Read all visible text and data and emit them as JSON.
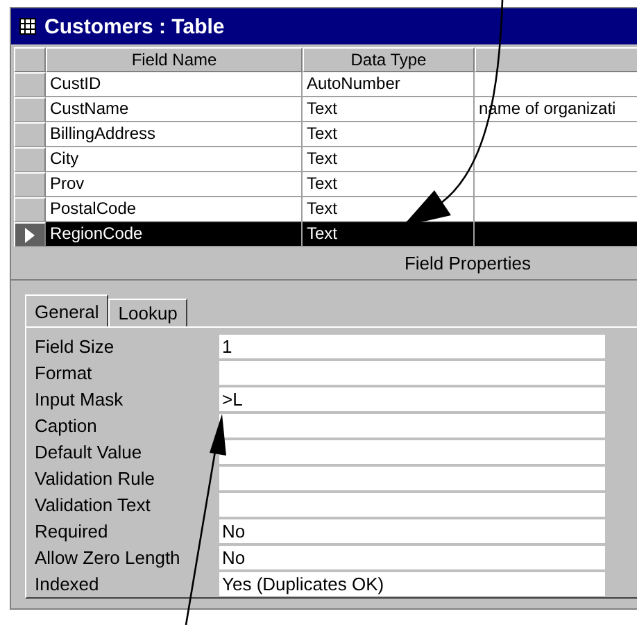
{
  "window": {
    "title": "Customers : Table"
  },
  "table": {
    "columns": [
      "Field Name",
      "Data Type"
    ],
    "rows": [
      {
        "field_name": "CustID",
        "data_type": "AutoNumber",
        "selected": false
      },
      {
        "field_name": "CustName",
        "data_type": "Text",
        "description": "name of organizati",
        "selected": false
      },
      {
        "field_name": "BillingAddress",
        "data_type": "Text",
        "selected": false
      },
      {
        "field_name": "City",
        "data_type": "Text",
        "selected": false
      },
      {
        "field_name": "Prov",
        "data_type": "Text",
        "selected": false
      },
      {
        "field_name": "PostalCode",
        "data_type": "Text",
        "selected": false
      },
      {
        "field_name": "RegionCode",
        "data_type": "Text",
        "selected": true
      }
    ]
  },
  "field_properties": {
    "title": "Field Properties",
    "tabs": [
      {
        "label": "General",
        "selected": true
      },
      {
        "label": "Lookup",
        "selected": false
      }
    ],
    "properties": [
      {
        "label": "Field Size",
        "value": "1"
      },
      {
        "label": "Format"
      },
      {
        "label": "Input Mask",
        "value": ">L"
      },
      {
        "label": "Caption"
      },
      {
        "label": "Default Value"
      },
      {
        "label": "Validation Rule"
      },
      {
        "label": "Validation Text"
      },
      {
        "label": "Required",
        "value": "No"
      },
      {
        "label": "Allow Zero Length",
        "value": "No"
      },
      {
        "label": "Indexed",
        "value": "Yes (Duplicates OK)"
      }
    ]
  }
}
